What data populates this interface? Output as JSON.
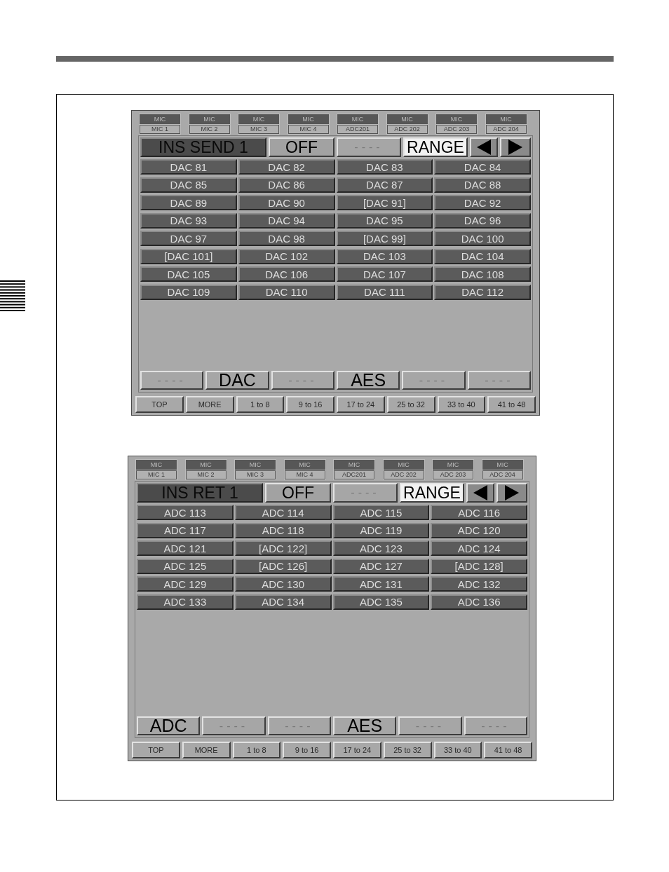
{
  "panels": [
    {
      "tabs": [
        {
          "type": "MIC",
          "channel": "MIC 1"
        },
        {
          "type": "MIC",
          "channel": "MIC 2"
        },
        {
          "type": "MIC",
          "channel": "MIC 3"
        },
        {
          "type": "MIC",
          "channel": "MIC 4"
        },
        {
          "type": "MIC",
          "channel": "ADC201"
        },
        {
          "type": "MIC",
          "channel": "ADC 202"
        },
        {
          "type": "MIC",
          "channel": "ADC 203"
        },
        {
          "type": "MIC",
          "channel": "ADC 204"
        }
      ],
      "header": {
        "title": "INS SEND 1",
        "mode": "OFF",
        "field": "----",
        "range": "RANGE"
      },
      "grid": [
        [
          "DAC 81",
          "DAC 82",
          "DAC 83",
          "DAC 84"
        ],
        [
          "DAC 85",
          "DAC 86",
          "DAC 87",
          "DAC 88"
        ],
        [
          "DAC 89",
          "DAC 90",
          "[DAC 91]",
          "DAC 92"
        ],
        [
          "DAC 93",
          "DAC 94",
          "DAC 95",
          "DAC 96"
        ],
        [
          "DAC 97",
          "DAC 98",
          "[DAC 99]",
          "DAC 100"
        ],
        [
          "[DAC 101]",
          "DAC 102",
          "DAC 103",
          "DAC 104"
        ],
        [
          "DAC 105",
          "DAC 106",
          "DAC 107",
          "DAC 108"
        ],
        [
          "DAC 109",
          "DAC 110",
          "DAC 111",
          "DAC 112"
        ]
      ],
      "sources": [
        {
          "label": "----",
          "assigned": false
        },
        {
          "label": "DAC",
          "assigned": true
        },
        {
          "label": "----",
          "assigned": false
        },
        {
          "label": "AES",
          "assigned": true
        },
        {
          "label": "----",
          "assigned": false
        },
        {
          "label": "----",
          "assigned": false
        }
      ],
      "nav": [
        "TOP",
        "MORE",
        "1 to 8",
        "9 to 16",
        "17 to 24",
        "25 to 32",
        "33 to 40",
        "41 to 48"
      ]
    },
    {
      "tabs": [
        {
          "type": "MIC",
          "channel": "MIC 1"
        },
        {
          "type": "MIC",
          "channel": "MIC 2"
        },
        {
          "type": "MIC",
          "channel": "MIC 3"
        },
        {
          "type": "MIC",
          "channel": "MIC 4"
        },
        {
          "type": "MIC",
          "channel": "ADC201"
        },
        {
          "type": "MIC",
          "channel": "ADC 202"
        },
        {
          "type": "MIC",
          "channel": "ADC 203"
        },
        {
          "type": "MIC",
          "channel": "ADC 204"
        }
      ],
      "header": {
        "title": "INS RET 1",
        "mode": "OFF",
        "field": "----",
        "range": "RANGE"
      },
      "grid": [
        [
          "ADC 113",
          "ADC 114",
          "ADC 115",
          "ADC 116"
        ],
        [
          "ADC 117",
          "ADC 118",
          "ADC 119",
          "ADC 120"
        ],
        [
          "ADC 121",
          "[ADC 122]",
          "ADC 123",
          "ADC 124"
        ],
        [
          "ADC 125",
          "[ADC 126]",
          "ADC 127",
          "[ADC 128]"
        ],
        [
          "ADC 129",
          "ADC 130",
          "ADC 131",
          "ADC 132"
        ],
        [
          "ADC 133",
          "ADC 134",
          "ADC 135",
          "ADC 136"
        ]
      ],
      "sources": [
        {
          "label": "ADC",
          "assigned": true
        },
        {
          "label": "----",
          "assigned": false
        },
        {
          "label": "----",
          "assigned": false
        },
        {
          "label": "AES",
          "assigned": true
        },
        {
          "label": "----",
          "assigned": false
        },
        {
          "label": "----",
          "assigned": false
        }
      ],
      "nav": [
        "TOP",
        "MORE",
        "1 to 8",
        "9 to 16",
        "17 to 24",
        "25 to 32",
        "33 to 40",
        "41 to 48"
      ]
    }
  ]
}
